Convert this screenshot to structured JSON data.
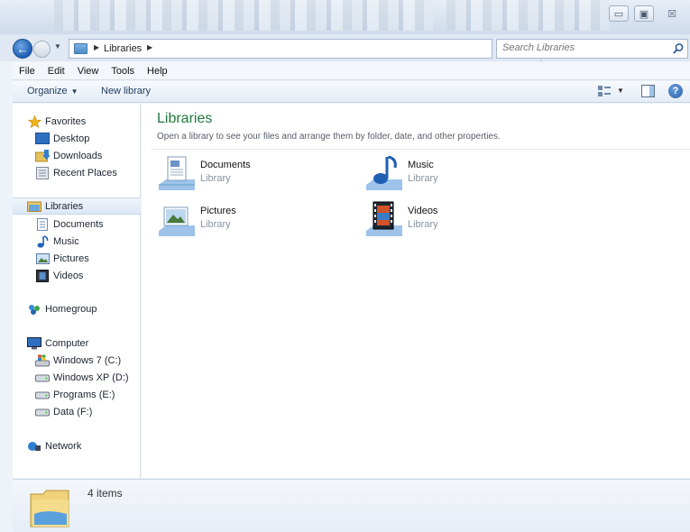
{
  "address": {
    "crumb": "Libraries",
    "search_placeholder": "Search Libraries"
  },
  "menu": [
    "File",
    "Edit",
    "View",
    "Tools",
    "Help"
  ],
  "command_bar": {
    "organize": "Organize",
    "new_library": "New library"
  },
  "nav": {
    "favorites": {
      "label": "Favorites",
      "items": [
        "Desktop",
        "Downloads",
        "Recent Places"
      ]
    },
    "libraries": {
      "label": "Libraries",
      "items": [
        "Documents",
        "Music",
        "Pictures",
        "Videos"
      ]
    },
    "homegroup": "Homegroup",
    "computer": {
      "label": "Computer",
      "items": [
        "Windows 7 (C:)",
        "Windows XP (D:)",
        "Programs (E:)",
        "Data (F:)"
      ]
    },
    "network": "Network"
  },
  "content": {
    "title": "Libraries",
    "subtitle": "Open a library to see your files and arrange them by folder, date, and other properties.",
    "libraries": [
      {
        "name": "Documents",
        "type": "Library",
        "icon": "documents-library-icon"
      },
      {
        "name": "Music",
        "type": "Library",
        "icon": "music-library-icon"
      },
      {
        "name": "Pictures",
        "type": "Library",
        "icon": "pictures-library-icon"
      },
      {
        "name": "Videos",
        "type": "Library",
        "icon": "videos-library-icon"
      }
    ]
  },
  "details": {
    "count": "4 items"
  },
  "colors": {
    "title_green": "#1f7a3c",
    "accent_blue": "#1f5fb3"
  }
}
